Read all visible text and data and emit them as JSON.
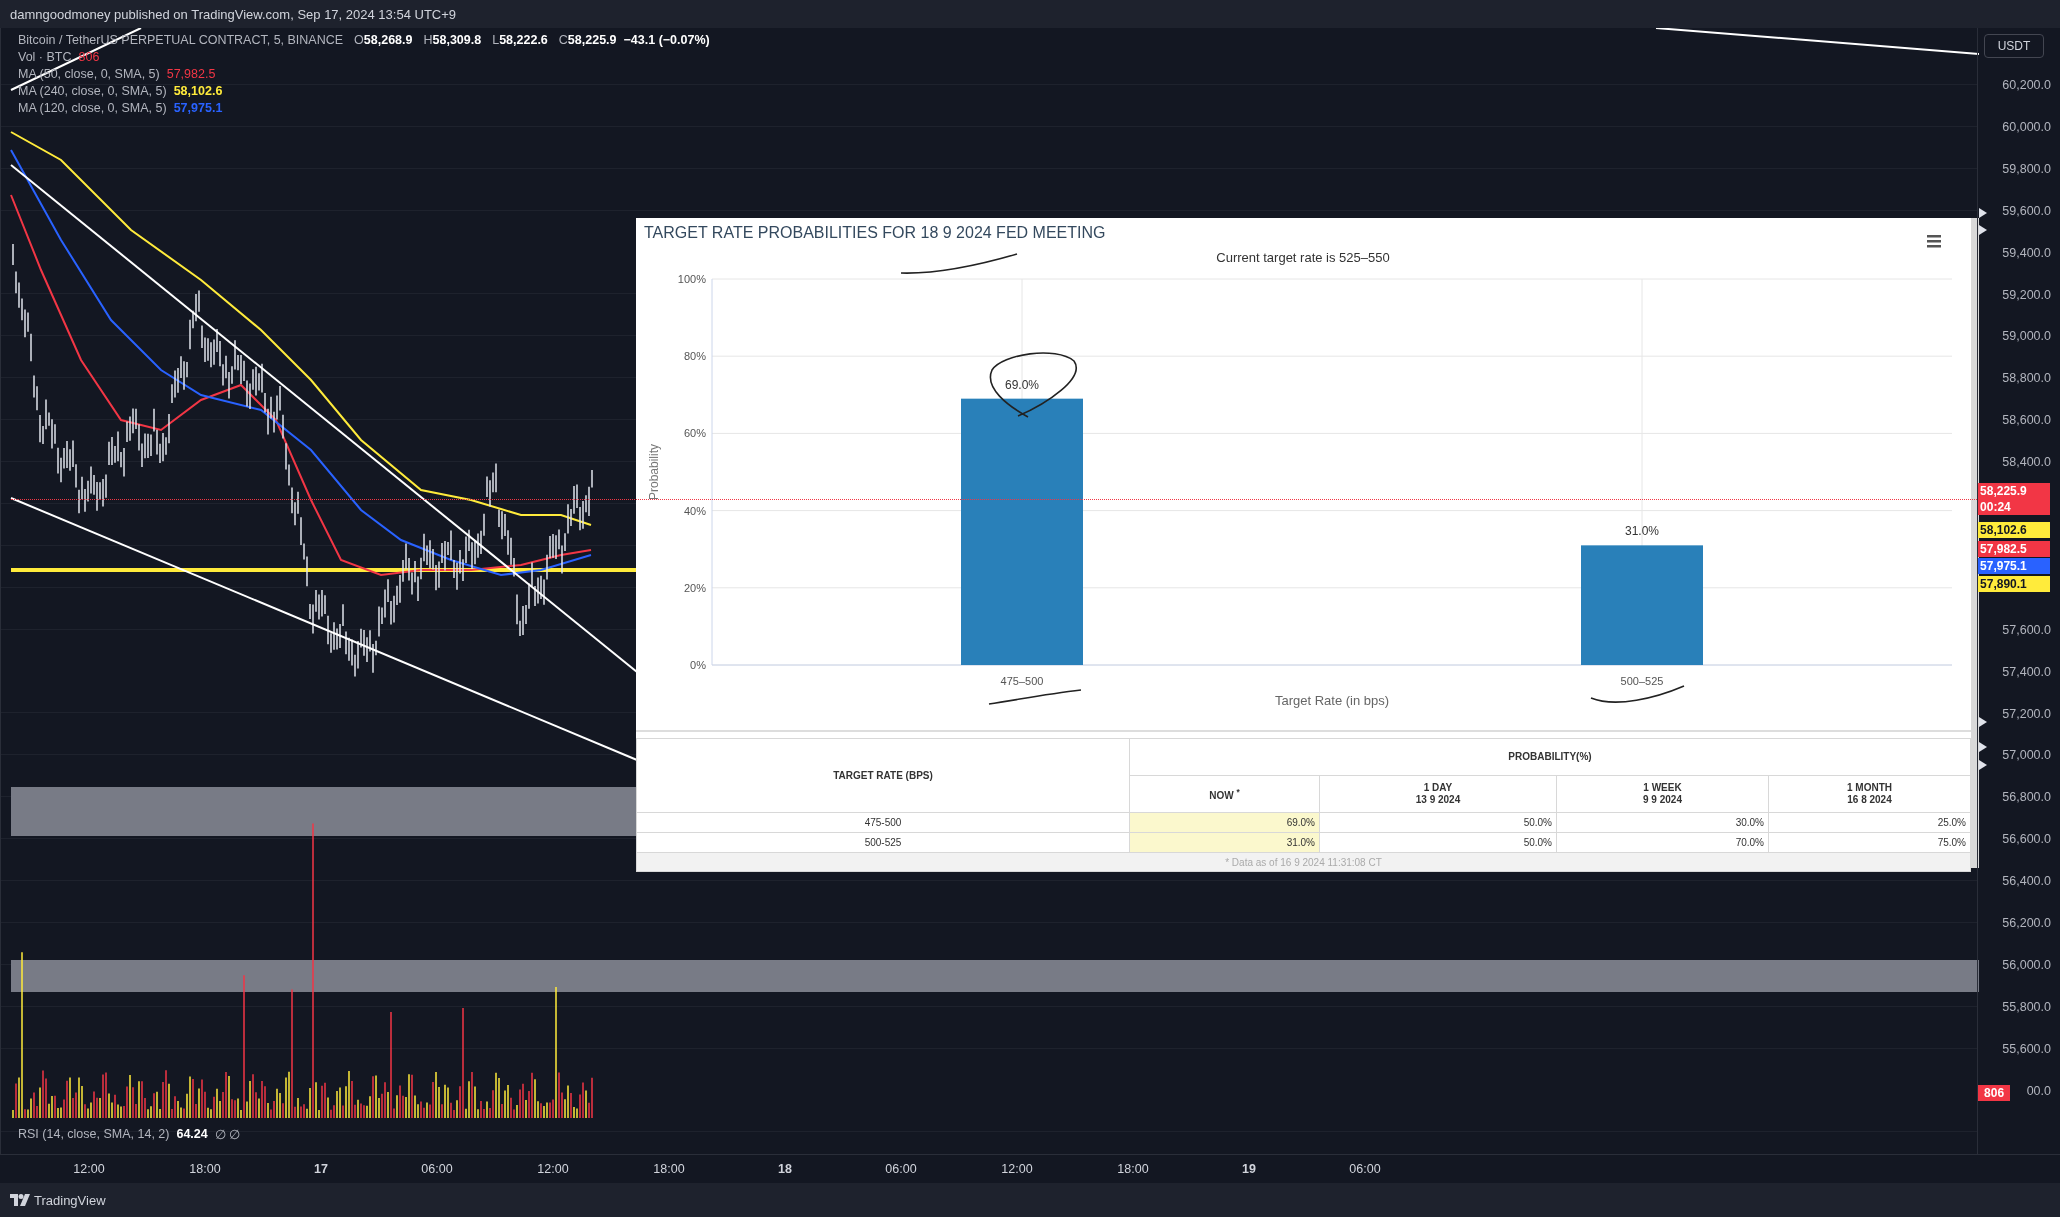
{
  "header": {
    "text": "damngoodmoney published on TradingView.com, Sep 17, 2024 13:54 UTC+9"
  },
  "legend": {
    "symbol": "Bitcoin / TetherUS PERPETUAL CONTRACT, 5, BINANCE",
    "ohlc": [
      {
        "label": "O",
        "value": "58,268.9"
      },
      {
        "label": "H",
        "value": "58,309.8"
      },
      {
        "label": "L",
        "value": "58,222.6"
      },
      {
        "label": "C",
        "value": "58,225.9"
      }
    ],
    "change": "−43.1 (−0.07%)",
    "indicators": [
      {
        "name": "Vol · BTC",
        "value": "806",
        "color": "#f23645"
      },
      {
        "name": "MA (50, close, 0, SMA, 5)",
        "value": "57,982.5",
        "color": "#f23645"
      },
      {
        "name": "MA (240, close, 0, SMA, 5)",
        "value": "58,102.6",
        "color": "#ffeb3b"
      },
      {
        "name": "MA (120, close, 0, SMA, 5)",
        "value": "57,975.1",
        "color": "#2962ff"
      }
    ]
  },
  "rsi_legend": {
    "name": "RSI (14, close, SMA, 14, 2)",
    "value": "64.24",
    "marks": "∅ ∅"
  },
  "price_axis": {
    "currency": "USDT",
    "ticks": [
      {
        "label": "60,200.0"
      },
      {
        "label": "60,000.0"
      },
      {
        "label": "59,800.0"
      },
      {
        "label": "59,600.0"
      },
      {
        "label": "59,400.0"
      },
      {
        "label": "59,200.0"
      },
      {
        "label": "59,000.0"
      },
      {
        "label": "58,800.0"
      },
      {
        "label": "58,600.0"
      },
      {
        "label": "58,400.0"
      },
      {
        "label": "57,600.0"
      },
      {
        "label": "57,400.0"
      },
      {
        "label": "57,200.0"
      },
      {
        "label": "57,000.0"
      },
      {
        "label": "56,800.0"
      },
      {
        "label": "56,600.0"
      },
      {
        "label": "56,400.0"
      },
      {
        "label": "56,200.0"
      },
      {
        "label": "56,000.0"
      },
      {
        "label": "55,800.0"
      },
      {
        "label": "55,600.0"
      },
      {
        "label": "00.0"
      }
    ],
    "tags": [
      {
        "value": "58,225.9",
        "sub": "00:24",
        "color": "#f23645"
      },
      {
        "value": "58,102.6",
        "color": "#ffeb3b"
      },
      {
        "value": "57,982.5",
        "color": "#f23645"
      },
      {
        "value": "57,975.1",
        "color": "#2962ff"
      },
      {
        "value": "57,890.1",
        "color": "#ffeb3b"
      },
      {
        "value": "806",
        "color": "#f23645"
      }
    ]
  },
  "time_axis": [
    {
      "label": "12:00",
      "kind": "time"
    },
    {
      "label": "18:00",
      "kind": "time"
    },
    {
      "label": "17",
      "kind": "day"
    },
    {
      "label": "06:00",
      "kind": "time"
    },
    {
      "label": "12:00",
      "kind": "time"
    },
    {
      "label": "18:00",
      "kind": "time"
    },
    {
      "label": "18",
      "kind": "day"
    },
    {
      "label": "06:00",
      "kind": "time"
    },
    {
      "label": "12:00",
      "kind": "time"
    },
    {
      "label": "18:00",
      "kind": "time"
    },
    {
      "label": "19",
      "kind": "day"
    },
    {
      "label": "06:00",
      "kind": "time"
    }
  ],
  "panel": {
    "subtitle": "Current target rate is 525–550",
    "chart_data": {
      "type": "bar",
      "title": "TARGET RATE PROBABILITIES FOR 18 9 2024 FED MEETING",
      "xlabel": "Target Rate (in bps)",
      "ylabel": "Probability",
      "categories": [
        "475–500",
        "500–525"
      ],
      "series": [
        {
          "color": "#2980b9",
          "values": [
            69.0,
            31.0
          ]
        }
      ],
      "grid": true,
      "ylim": [
        0,
        100
      ],
      "yticks": [
        {
          "value": 0,
          "label": "0%"
        },
        {
          "value": 20,
          "label": "20%"
        },
        {
          "value": 40,
          "label": "40%"
        },
        {
          "value": 60,
          "label": "60%"
        },
        {
          "value": 80,
          "label": "80%"
        },
        {
          "value": 100,
          "label": "100%"
        }
      ],
      "value_labels": [
        "69.0%",
        "31.0%"
      ]
    },
    "table": {
      "row_header": "TARGET RATE (BPS)",
      "group_header": "PROBABILITY(%)",
      "columns": [
        {
          "label": "NOW $^{*}$",
          "highlight": true
        },
        {
          "label": "1 DAY",
          "date": "13 9 2024",
          "highlight": false
        },
        {
          "label": "1 WEEK",
          "date": "9 9 2024",
          "highlight": false
        },
        {
          "label": "1 MONTH",
          "date": "16 8 2024",
          "highlight": false
        }
      ],
      "rows": [
        {
          "rate": "475-500",
          "cells": [
            "69.0%",
            "50.0%",
            "30.0%",
            "25.0%"
          ]
        },
        {
          "rate": "500-525",
          "cells": [
            "31.0%",
            "50.0%",
            "70.0%",
            "75.0%"
          ]
        }
      ],
      "footnote": "* Data as of 16 9 2024 11:31:08 CT"
    }
  },
  "footer": {
    "brand": "TradingView"
  }
}
